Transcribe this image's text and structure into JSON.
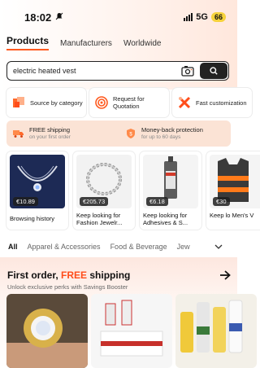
{
  "status": {
    "time": "18:02",
    "network": "5G",
    "battery": "66"
  },
  "tabs": [
    "Products",
    "Manufacturers",
    "Worldwide"
  ],
  "search": {
    "value": "electric heated vest"
  },
  "features": [
    {
      "label": "Source by category"
    },
    {
      "label": "Request for Quotation"
    },
    {
      "label": "Fast customization"
    }
  ],
  "benefits": [
    {
      "title": "FREE shipping",
      "subtitle": "on your first order"
    },
    {
      "title": "Money-back protection",
      "subtitle": "for up to 60 days"
    }
  ],
  "products": [
    {
      "price": "€10.89",
      "label": "Browsing history"
    },
    {
      "price": "€205.73",
      "label": "Keep looking for Fashion Jewelr..."
    },
    {
      "price": "€6.18",
      "label": "Keep looking for Adhesives & S..."
    },
    {
      "price": "€30",
      "label": "Keep lo Men's V"
    }
  ],
  "categories": [
    "All",
    "Apparel & Accessories",
    "Food & Beverage",
    "Jew"
  ],
  "promo": {
    "title_prefix": "First order, ",
    "title_highlight": "FREE",
    "title_suffix": " shipping",
    "subtitle": "Unlock exclusive perks with Savings Booster"
  },
  "colors": {
    "accent": "#ff5a1f",
    "free_text": "#ff4d1a",
    "benefit_bg": "#fbe3d5"
  }
}
